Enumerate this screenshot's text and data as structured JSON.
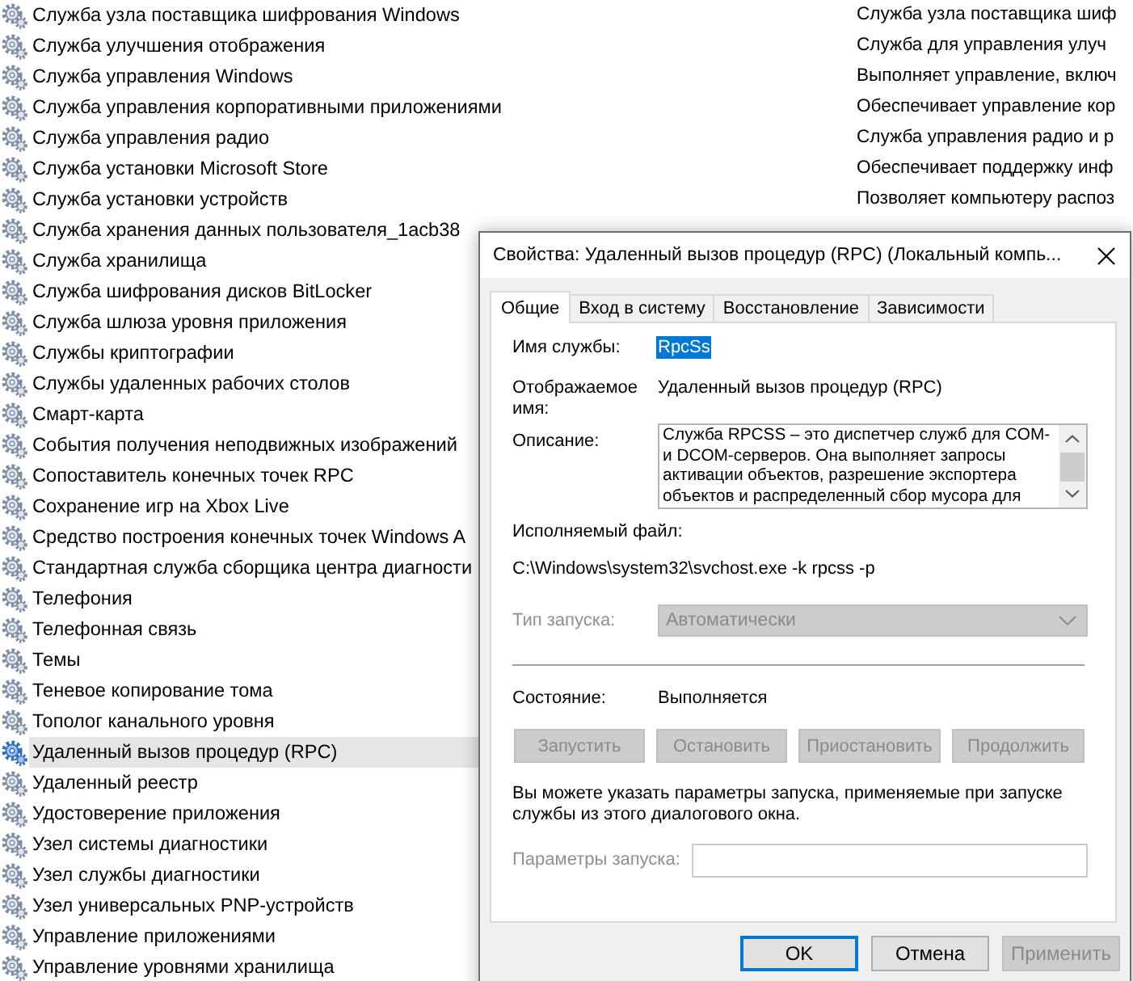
{
  "services": {
    "rows": [
      {
        "name": "Служба узла поставщика шифрования Windows",
        "description": "Служба узла поставщика шиф",
        "selected": false
      },
      {
        "name": "Служба улучшения отображения",
        "description": "Служба для управления улуч",
        "selected": false
      },
      {
        "name": "Служба управления Windows",
        "description": "Выполняет управление, включ",
        "selected": false
      },
      {
        "name": "Служба управления корпоративными приложениями",
        "description": "Обеспечивает управление кор",
        "selected": false
      },
      {
        "name": "Служба управления радио",
        "description": "Служба управления радио и р",
        "selected": false
      },
      {
        "name": "Служба установки Microsoft Store",
        "description": "Обеспечивает поддержку инф",
        "selected": false
      },
      {
        "name": "Служба установки устройств",
        "description": "Позволяет компьютеру распоз",
        "selected": false
      },
      {
        "name": "Служба хранения данных пользователя_1acb38",
        "selected": false
      },
      {
        "name": "Служба хранилища",
        "selected": false
      },
      {
        "name": "Служба шифрования дисков BitLocker",
        "selected": false
      },
      {
        "name": "Служба шлюза уровня приложения",
        "selected": false
      },
      {
        "name": "Службы криптографии",
        "selected": false
      },
      {
        "name": "Службы удаленных рабочих столов",
        "selected": false
      },
      {
        "name": "Смарт-карта",
        "selected": false
      },
      {
        "name": "События получения неподвижных изображений",
        "selected": false
      },
      {
        "name": "Сопоставитель конечных точек RPC",
        "selected": false
      },
      {
        "name": "Сохранение игр на Xbox Live",
        "selected": false
      },
      {
        "name": "Средство построения конечных точек Windows A",
        "selected": false
      },
      {
        "name": "Стандартная служба сборщика центра диагности",
        "selected": false
      },
      {
        "name": "Телефония",
        "selected": false
      },
      {
        "name": "Телефонная связь",
        "selected": false
      },
      {
        "name": "Темы",
        "selected": false
      },
      {
        "name": "Теневое копирование тома",
        "selected": false
      },
      {
        "name": "Тополог канального уровня",
        "selected": false
      },
      {
        "name": "Удаленный вызов процедур (RPC)",
        "selected": true
      },
      {
        "name": "Удаленный реестр",
        "selected": false
      },
      {
        "name": "Удостоверение приложения",
        "selected": false
      },
      {
        "name": "Узел системы диагностики",
        "selected": false
      },
      {
        "name": "Узел службы диагностики",
        "selected": false
      },
      {
        "name": "Узел универсальных PNP-устройств",
        "selected": false
      },
      {
        "name": "Управление приложениями",
        "selected": false
      },
      {
        "name": "Управление уровнями хранилища",
        "selected": false
      }
    ]
  },
  "dialog": {
    "title": "Свойства: Удаленный вызов процедур (RPC) (Локальный компь...",
    "tabs": [
      {
        "label": "Общие",
        "selected": true
      },
      {
        "label": "Вход в систему",
        "selected": false
      },
      {
        "label": "Восстановление",
        "selected": false
      },
      {
        "label": "Зависимости",
        "selected": false
      }
    ],
    "service_name": {
      "label": "Имя службы:",
      "value": "RpcSs",
      "highlighted": true
    },
    "display_name": {
      "label": "Отображаемое имя:",
      "value": "Удаленный вызов процедур (RPC)"
    },
    "description": {
      "label": "Описание:",
      "value": "Служба RPCSS – это диспетчер служб для COM- и DCOM-серверов. Она выполняет запросы активации объектов, разрешение экспортера объектов и распределенный сбор мусора для"
    },
    "executable": {
      "label": "Исполняемый файл:",
      "value": "C:\\Windows\\system32\\svchost.exe -k rpcss -p"
    },
    "startup_type": {
      "label": "Тип запуска:",
      "value": "Автоматически",
      "disabled": true
    },
    "status": {
      "label": "Состояние:",
      "value": "Выполняется"
    },
    "service_buttons": [
      {
        "label": "Запустить",
        "disabled": true
      },
      {
        "label": "Остановить",
        "disabled": true
      },
      {
        "label": "Приостановить",
        "disabled": true
      },
      {
        "label": "Продолжить",
        "disabled": true
      }
    ],
    "note": "Вы можете указать параметры запуска, применяемые при запуске службы из этого диалогового окна.",
    "start_parameters": {
      "label": "Параметры запуска:",
      "disabled": true
    },
    "footer_buttons": [
      {
        "label": "OK",
        "default": true,
        "disabled": false
      },
      {
        "label": "Отмена",
        "default": false,
        "disabled": false
      },
      {
        "label": "Применить",
        "default": false,
        "disabled": true
      }
    ]
  }
}
